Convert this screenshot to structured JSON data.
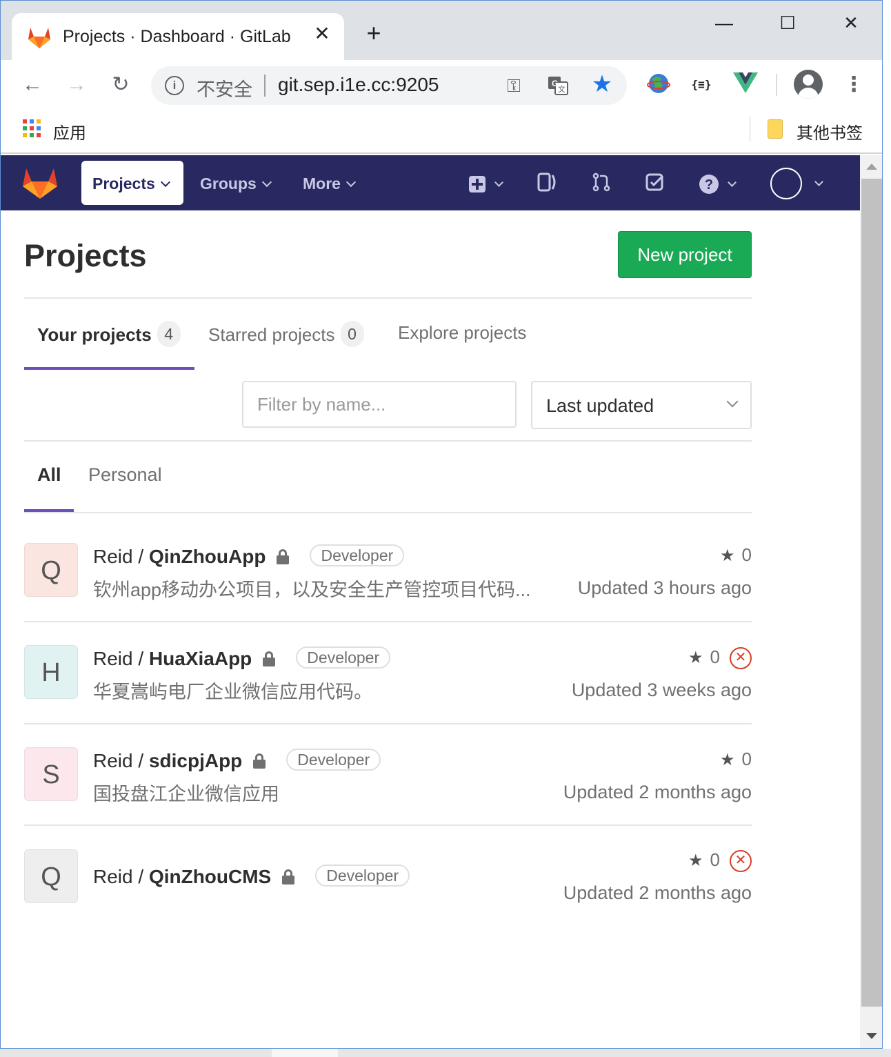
{
  "browser": {
    "tab_title": "Projects · Dashboard · GitLab",
    "tab_close": "✕",
    "new_tab": "+",
    "minimize": "—",
    "maximize": "☐",
    "close": "✕",
    "security_label": "不安全",
    "url": "git.sep.i1e.cc:9205",
    "bookmarks": {
      "apps_label": "应用",
      "other_label": "其他书签"
    }
  },
  "gitlab_nav": {
    "projects": "Projects",
    "groups": "Groups",
    "more": "More"
  },
  "page": {
    "title": "Projects",
    "new_project_button": "New project",
    "tabs": [
      {
        "label": "Your projects",
        "count": "4"
      },
      {
        "label": "Starred projects",
        "count": "0"
      },
      {
        "label": "Explore projects"
      }
    ],
    "filter": {
      "placeholder": "Filter by name..."
    },
    "sort": {
      "selected": "Last updated"
    },
    "subtabs": [
      {
        "label": "All"
      },
      {
        "label": "Personal"
      }
    ]
  },
  "projects": [
    {
      "initial": "Q",
      "namespace": "Reid / ",
      "name": "QinZhouApp",
      "role": "Developer",
      "description": "钦州app移动办公项目，以及安全生产管控项目代码...",
      "stars": "0",
      "updated": "Updated 3 hours ago",
      "pipeline_failed": false,
      "avatar_color": "#fbe5e1"
    },
    {
      "initial": "H",
      "namespace": "Reid / ",
      "name": "HuaXiaApp",
      "role": "Developer",
      "description": "华夏嵩屿电厂企业微信应用代码。",
      "stars": "0",
      "updated": "Updated 3 weeks ago",
      "pipeline_failed": true,
      "avatar_color": "#e0f2f1"
    },
    {
      "initial": "S",
      "namespace": "Reid / ",
      "name": "sdicpjApp",
      "role": "Developer",
      "description": "国投盘江企业微信应用",
      "stars": "0",
      "updated": "Updated 2 months ago",
      "pipeline_failed": false,
      "avatar_color": "#fce8ec"
    },
    {
      "initial": "Q",
      "namespace": "Reid / ",
      "name": "QinZhouCMS",
      "role": "Developer",
      "description": "",
      "stars": "0",
      "updated": "Updated 2 months ago",
      "pipeline_failed": true,
      "avatar_color": "#eeeeee"
    }
  ],
  "colors": {
    "navbar": "#292961",
    "accent": "#6b4fbb",
    "success": "#1aaa55",
    "failed": "#db3b21"
  }
}
